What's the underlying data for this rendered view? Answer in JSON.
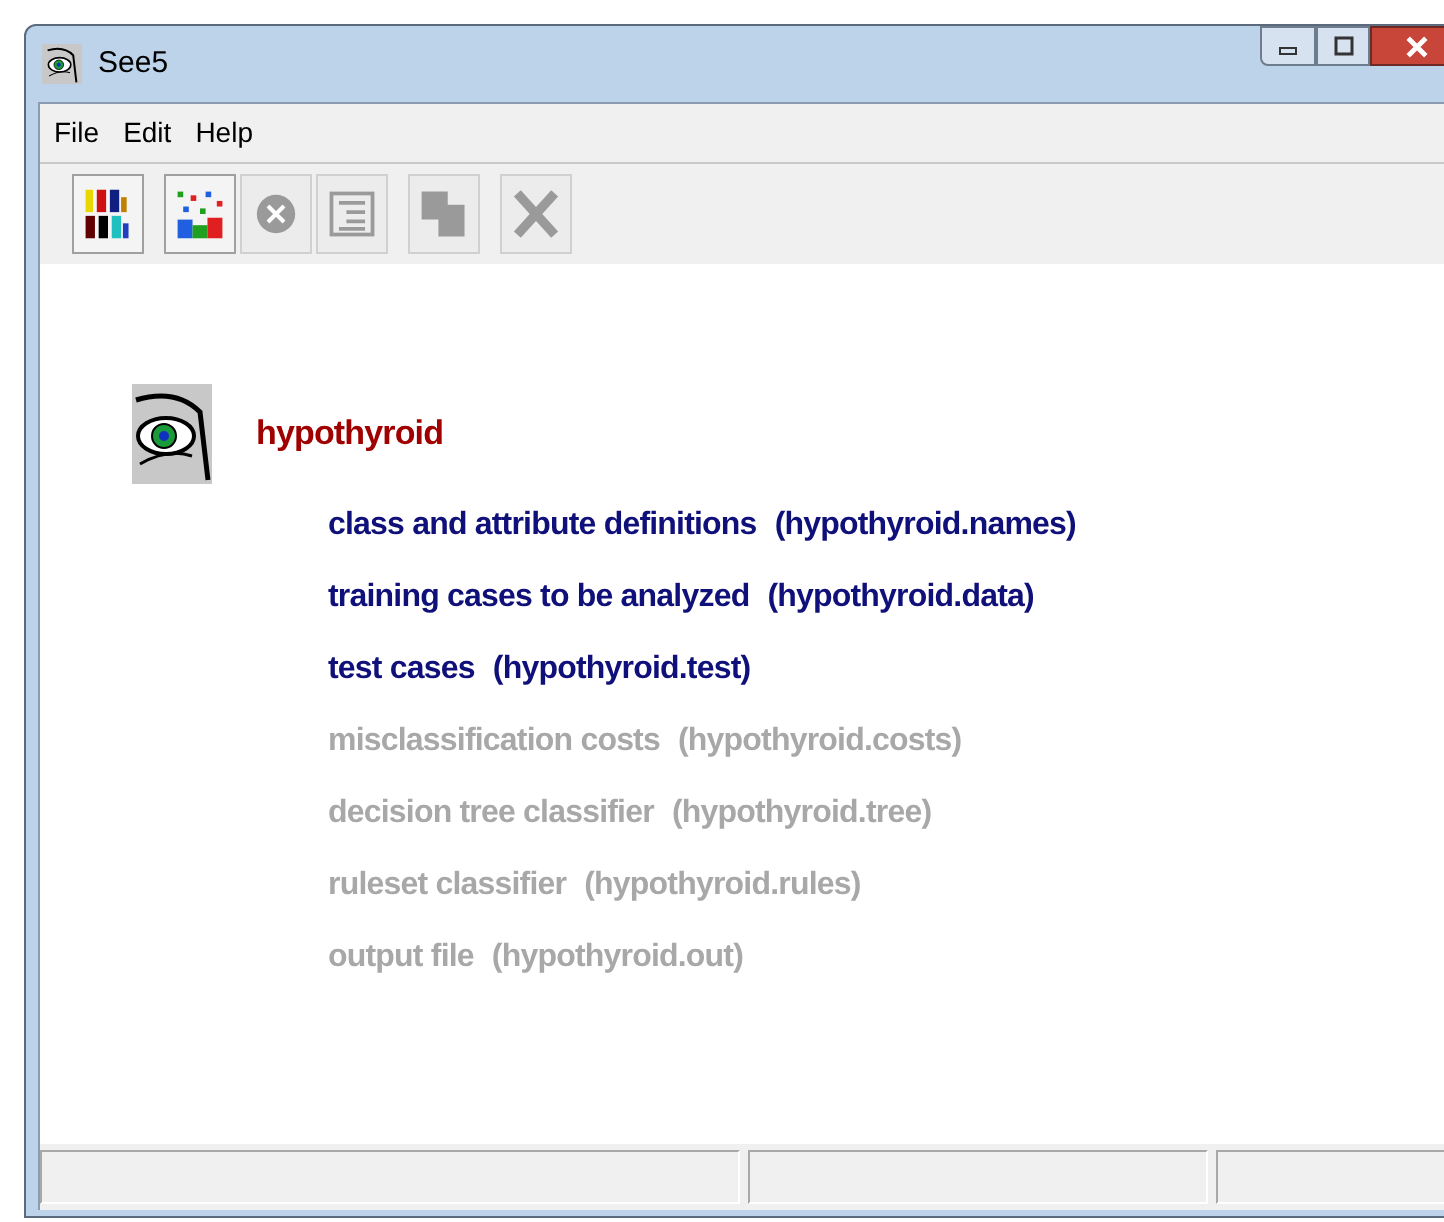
{
  "window": {
    "title": "See5"
  },
  "menu": [
    "File",
    "Edit",
    "Help"
  ],
  "toolbar": [
    {
      "kind": "digits",
      "disabled": false
    },
    {
      "kind": "mosaic",
      "disabled": false
    },
    {
      "kind": "stop",
      "disabled": true
    },
    {
      "kind": "list",
      "disabled": true
    },
    {
      "kind": "copy",
      "disabled": true
    },
    {
      "kind": "cross",
      "disabled": true
    }
  ],
  "project": {
    "name": "hypothyroid"
  },
  "files": [
    {
      "label": "class and attribute definitions",
      "file": "(hypothyroid.names)",
      "disabled": false
    },
    {
      "label": "training cases to be analyzed",
      "file": "(hypothyroid.data)",
      "disabled": false
    },
    {
      "label": "test cases",
      "file": "(hypothyroid.test)",
      "disabled": false
    },
    {
      "label": "misclassification costs",
      "file": "(hypothyroid.costs)",
      "disabled": true
    },
    {
      "label": "decision tree classifier",
      "file": "(hypothyroid.tree)",
      "disabled": true
    },
    {
      "label": "ruleset classifier",
      "file": "(hypothyroid.rules)",
      "disabled": true
    },
    {
      "label": "output file",
      "file": "(hypothyroid.out)",
      "disabled": true
    }
  ]
}
